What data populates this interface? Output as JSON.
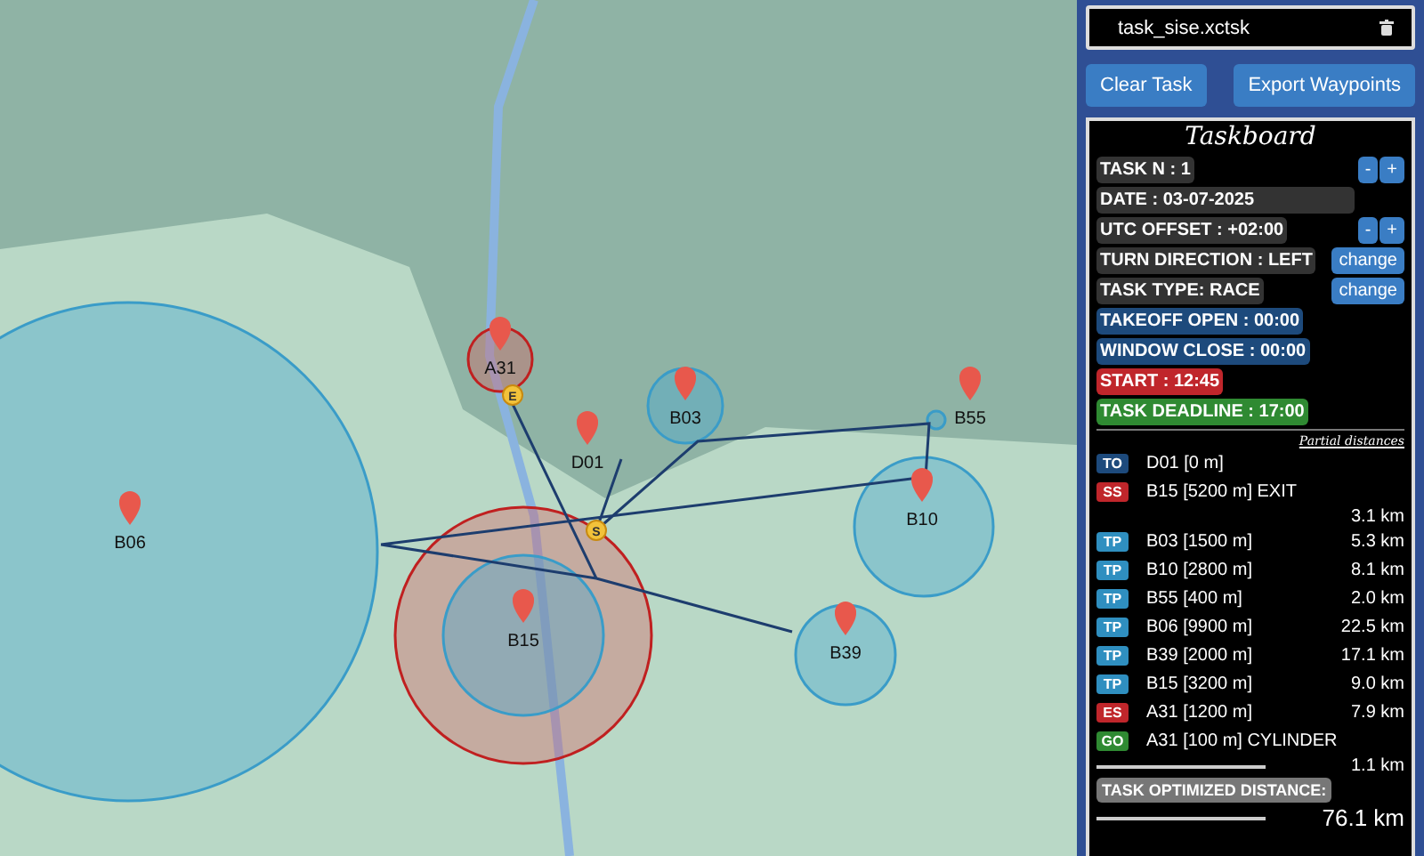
{
  "map": {
    "waypoints": [
      {
        "label": "B06"
      },
      {
        "label": "B15"
      },
      {
        "label": "A31"
      },
      {
        "label": "D01"
      },
      {
        "label": "B03"
      },
      {
        "label": "B55"
      },
      {
        "label": "B10"
      },
      {
        "label": "B39"
      }
    ],
    "markers": [
      "S",
      "E"
    ]
  },
  "file": {
    "name": "task_sise.xctsk"
  },
  "buttons": [
    "Clear Task",
    "Export Waypoints"
  ],
  "taskboard": {
    "title": "Taskboard",
    "fields": [
      {
        "text": "TASK N : 1",
        "color": "#333333",
        "controls": [
          "-",
          "+"
        ]
      },
      {
        "text": "DATE : 03-07-2025",
        "color": "#333333",
        "wide": true
      },
      {
        "text": "UTC OFFSET : +02:00",
        "color": "#333333",
        "controls": [
          "-",
          "+"
        ]
      },
      {
        "text": "TURN DIRECTION : LEFT",
        "color": "#333333",
        "controls": [
          "change"
        ]
      },
      {
        "text": "TASK TYPE: RACE",
        "color": "#333333",
        "controls": [
          "change"
        ]
      },
      {
        "text": "TAKEOFF OPEN : 00:00",
        "color": "#1d4a7c"
      },
      {
        "text": "WINDOW CLOSE : 00:00",
        "color": "#1d4a7c"
      },
      {
        "text": "START : 12:45",
        "color": "#c0262b"
      },
      {
        "text": "TASK DEADLINE : 17:00",
        "color": "#2f8a32"
      }
    ],
    "partial_label": "Partial distances",
    "items": [
      {
        "kind": "point",
        "tag": "TO",
        "color": "#1d4a7c",
        "name": "D01 [0 m]"
      },
      {
        "kind": "point",
        "tag": "SS",
        "color": "#c0262b",
        "name": "B15 [5200 m] EXIT"
      },
      {
        "kind": "leg",
        "distance": "3.1 km"
      },
      {
        "kind": "point",
        "tag": "TP",
        "color": "#2f8fc0",
        "name": "B03 [1500 m]",
        "distance": "5.3 km"
      },
      {
        "kind": "point",
        "tag": "TP",
        "color": "#2f8fc0",
        "name": "B10 [2800 m]",
        "distance": "8.1 km"
      },
      {
        "kind": "point",
        "tag": "TP",
        "color": "#2f8fc0",
        "name": "B55 [400 m]",
        "distance": "2.0 km"
      },
      {
        "kind": "point",
        "tag": "TP",
        "color": "#2f8fc0",
        "name": "B06 [9900 m]",
        "distance": "22.5 km"
      },
      {
        "kind": "point",
        "tag": "TP",
        "color": "#2f8fc0",
        "name": "B39 [2000 m]",
        "distance": "17.1 km"
      },
      {
        "kind": "point",
        "tag": "TP",
        "color": "#2f8fc0",
        "name": "B15 [3200 m]",
        "distance": "9.0 km"
      },
      {
        "kind": "point",
        "tag": "ES",
        "color": "#c0262b",
        "name": "A31 [1200 m]",
        "distance": "7.9 km"
      },
      {
        "kind": "point",
        "tag": "GO",
        "color": "#2f8a32",
        "name": "A31 [100 m] CYLINDER"
      },
      {
        "kind": "total",
        "distance": "1.1 km"
      }
    ],
    "total_label": "TASK OPTIMIZED DISTANCE:",
    "total": "76.1 km"
  }
}
